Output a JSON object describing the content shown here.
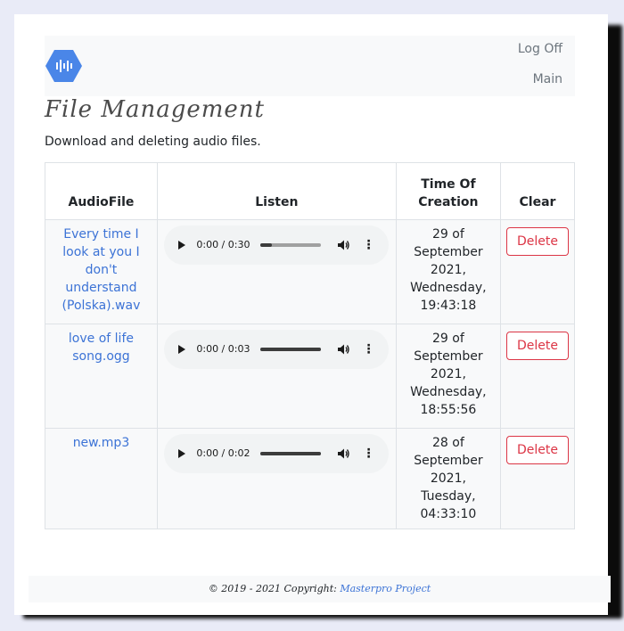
{
  "nav": {
    "links": [
      "Log Off",
      "Main"
    ]
  },
  "page_title": "File Management",
  "subtitle": "Download and deleting audio files.",
  "table": {
    "headers": {
      "audiofile": "AudioFile",
      "listen": "Listen",
      "time_of_creation": "Time Of Creation",
      "clear": "Clear"
    },
    "rows": [
      {
        "file": "Every time I look at you I don't understand (Polska).wav",
        "player": {
          "time": "0:00 / 0:30",
          "progress": 0.18
        },
        "created": "29 of September 2021, Wednesday, 19:43:18",
        "action": "Delete"
      },
      {
        "file": "love of life song.ogg",
        "player": {
          "time": "0:00 / 0:03",
          "progress": 1.0
        },
        "created": "29 of September 2021, Wednesday, 18:55:56",
        "action": "Delete"
      },
      {
        "file": "new.mp3",
        "player": {
          "time": "0:00 / 0:02",
          "progress": 1.0
        },
        "created": "28 of September 2021, Tuesday, 04:33:10",
        "action": "Delete"
      }
    ]
  },
  "footer": {
    "text": "© 2019 - 2021 Copyright:",
    "link": "Masterpro Project"
  },
  "colors": {
    "link": "#3c73d6",
    "danger": "#dc3545",
    "logo": "#4a86e8"
  },
  "icons": [
    "audio-logo-icon",
    "play-icon",
    "volume-icon",
    "more-options-icon"
  ]
}
